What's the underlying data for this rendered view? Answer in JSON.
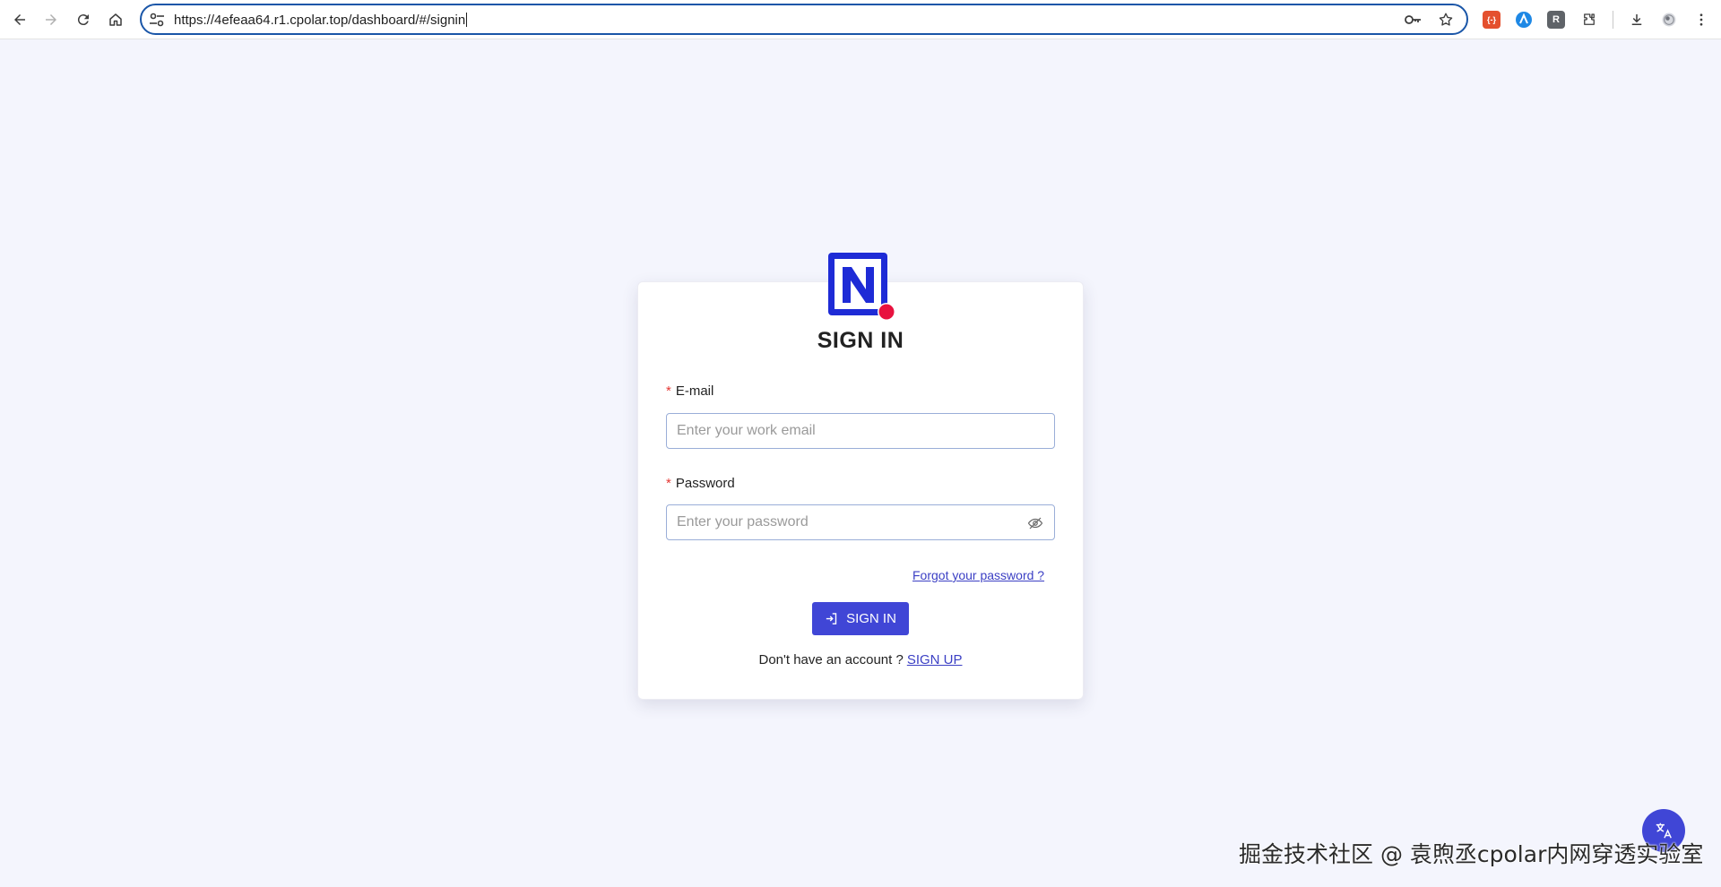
{
  "browser": {
    "url": "https://4efeaa64.r1.cpolar.top/dashboard/#/signin",
    "extensions": [
      {
        "name": "json-extension",
        "label": "{-}",
        "color": "#e4502e"
      },
      {
        "name": "arc-extension",
        "label": "",
        "color": "#1e88e5"
      },
      {
        "name": "r-extension",
        "label": "R",
        "color": "#5f6368"
      }
    ]
  },
  "signin": {
    "title": "SIGN IN",
    "email_label": "E-mail",
    "email_placeholder": "Enter your work email",
    "password_label": "Password",
    "password_placeholder": "Enter your password",
    "required_marker": "*",
    "forgot_link": "Forgot your password ?",
    "submit_label": "SIGN IN",
    "no_account_text": "Don't have an account ?",
    "signup_link": "SIGN UP"
  },
  "colors": {
    "accent": "#4046d6",
    "logo_blue": "#1e2bd6",
    "logo_dot": "#e8123f",
    "page_bg": "#f4f5fd"
  },
  "watermark": "掘金技术社区 @ 袁煦丞cpolar内网穿透实验室"
}
